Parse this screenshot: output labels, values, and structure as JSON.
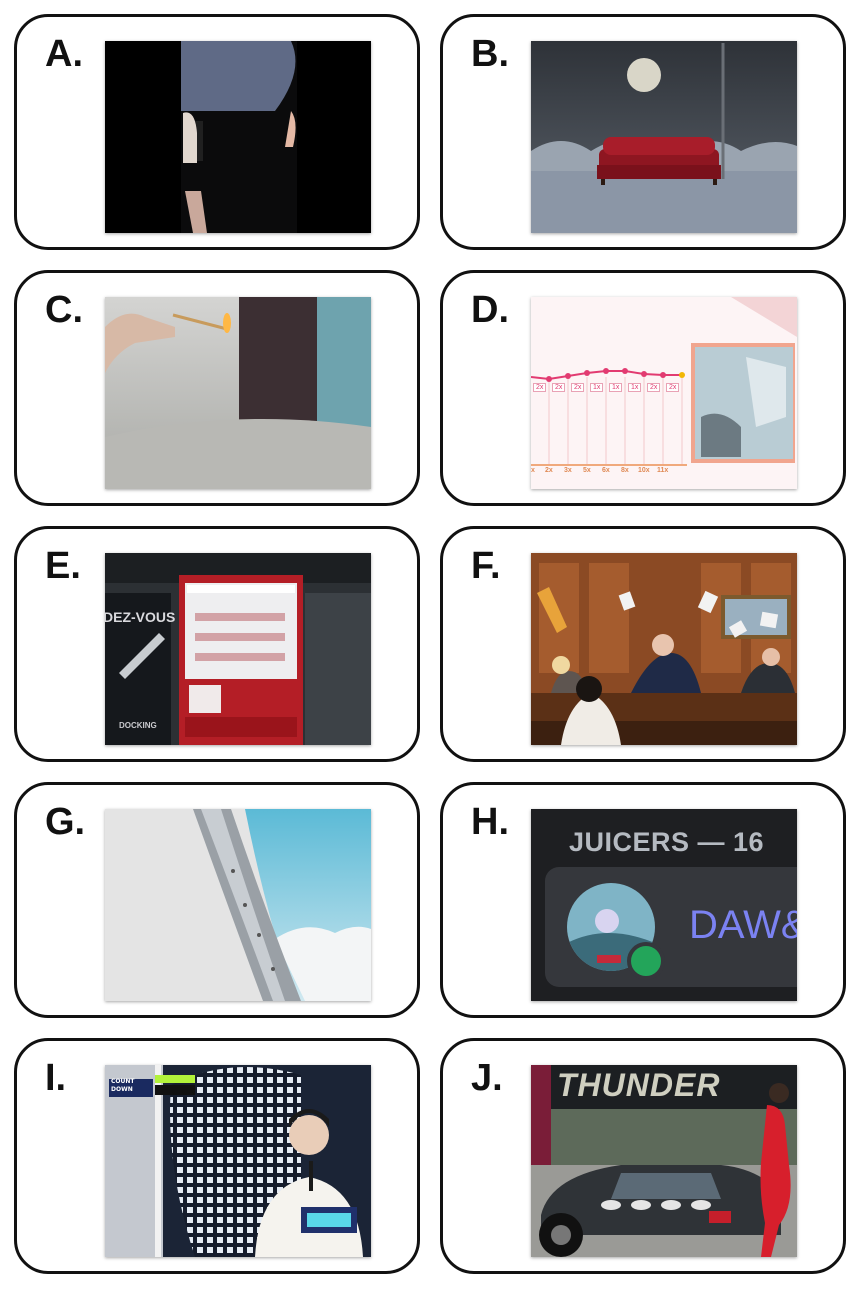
{
  "panels": [
    {
      "id": "A",
      "label": "A."
    },
    {
      "id": "B",
      "label": "B."
    },
    {
      "id": "C",
      "label": "C."
    },
    {
      "id": "D",
      "label": "D.",
      "chart_labels": [
        "2x",
        "2x",
        "2x",
        "1x",
        "1x",
        "1x",
        "2x",
        "2x"
      ],
      "axis_labels": [
        "x",
        "2x",
        "3x",
        "5x",
        "6x",
        "8x",
        "10x",
        "11x"
      ]
    },
    {
      "id": "E",
      "label": "E.",
      "poster_text": "DEZ-VOUS",
      "poster_sub": "DOCKING"
    },
    {
      "id": "F",
      "label": "F."
    },
    {
      "id": "G",
      "label": "G."
    },
    {
      "id": "H",
      "label": "H.",
      "group_header": "JUICERS — 16",
      "member_name": "DAW&"
    },
    {
      "id": "I",
      "label": "I.",
      "logo_top": "COUNT",
      "logo_bottom": "DOWN"
    },
    {
      "id": "J",
      "label": "J.",
      "banner": "THUNDER"
    }
  ],
  "colors": {
    "border": "#111111",
    "discord_bg": "#1e1f22",
    "discord_row": "#35373c",
    "status_online": "#23a55a",
    "name_color": "#7b82f2"
  }
}
